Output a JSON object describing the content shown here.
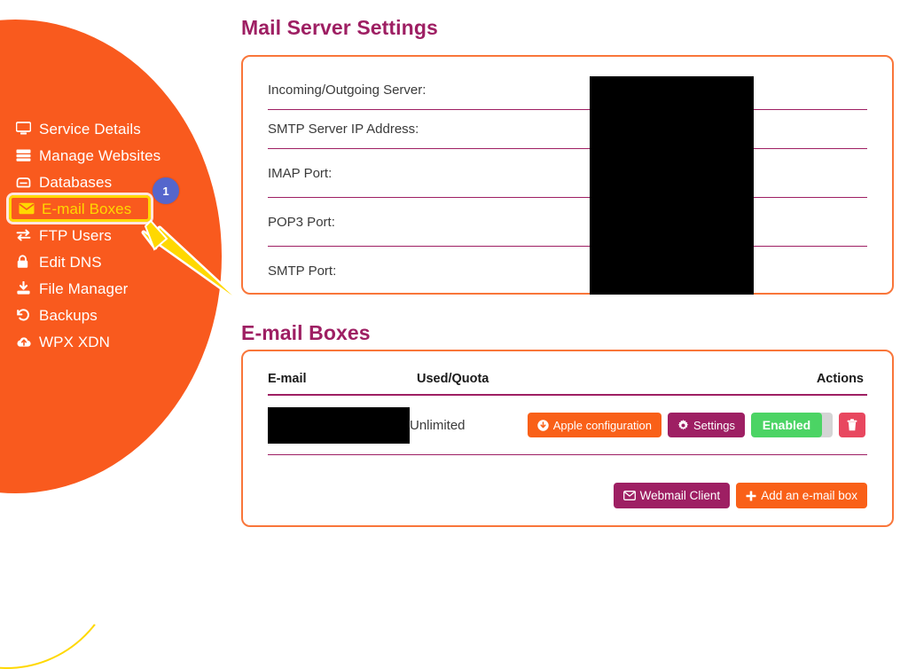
{
  "sidebar": {
    "items": [
      {
        "label": "Service Details",
        "icon": "monitor-icon",
        "active": false
      },
      {
        "label": "Manage Websites",
        "icon": "server-stack-icon",
        "active": false
      },
      {
        "label": "Databases",
        "icon": "database-icon",
        "active": false
      },
      {
        "label": "E-mail Boxes",
        "icon": "envelope-icon",
        "active": true
      },
      {
        "label": "FTP Users",
        "icon": "transfer-icon",
        "active": false
      },
      {
        "label": "Edit DNS",
        "icon": "lock-icon",
        "active": false
      },
      {
        "label": "File Manager",
        "icon": "download-icon",
        "active": false
      },
      {
        "label": "Backups",
        "icon": "history-icon",
        "active": false
      },
      {
        "label": "WPX XDN",
        "icon": "cloud-upload-icon",
        "active": false
      }
    ],
    "badge": "1"
  },
  "mail_server": {
    "title": "Mail Server Settings",
    "rows": [
      {
        "label": "Incoming/Outgoing Server:",
        "value": ""
      },
      {
        "label": "SMTP Server IP Address:",
        "value": ""
      },
      {
        "label": "IMAP Port:",
        "value": ""
      },
      {
        "label": "POP3 Port:",
        "value": ""
      },
      {
        "label": "SMTP Port:",
        "value": ""
      }
    ]
  },
  "email_boxes": {
    "title": "E-mail Boxes",
    "columns": {
      "email": "E-mail",
      "quota": "Used/Quota",
      "actions": "Actions"
    },
    "rows": [
      {
        "email": "",
        "quota": "Unlimited",
        "apple_config_label": "Apple configuration",
        "settings_label": "Settings",
        "toggle_label": "Enabled",
        "delete_label": ""
      }
    ],
    "footer": {
      "webmail_label": "Webmail Client",
      "add_label": "Add an e-mail box"
    }
  },
  "colors": {
    "brand_orange": "#f95a1e",
    "panel_border": "#f9763a",
    "plum": "#9e1f63",
    "highlight_yellow": "#ffd800",
    "badge_blue": "#5566cc",
    "toggle_green": "#4bd464",
    "delete_red": "#e8475f"
  }
}
